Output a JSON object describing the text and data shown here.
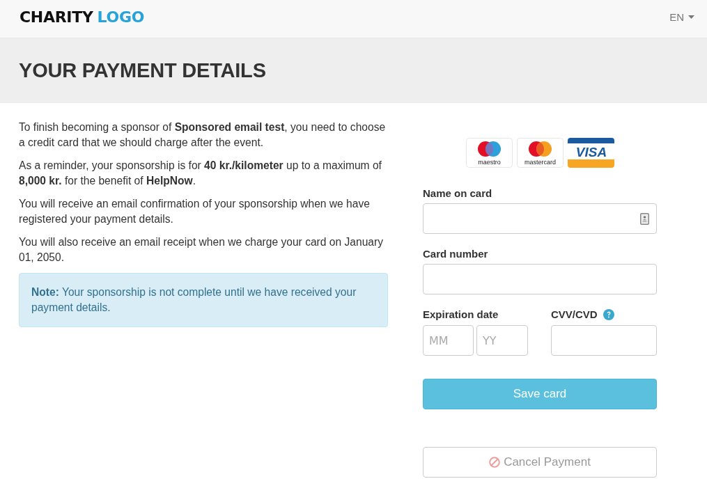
{
  "header": {
    "logo": {
      "primary": "CHARITY",
      "accent": "LOGO"
    },
    "language": "EN"
  },
  "page_title": "YOUR PAYMENT DETAILS",
  "intro_paragraphs": [
    "To finish becoming a sponsor of **Sponsored email test**, you need to choose a credit card that we should charge after the event.",
    "As a reminder, your sponsorship is for **40 kr./kilometer** up to a maximum of **8,000 kr.** for the benefit of **HelpNow**.",
    "You will receive an email confirmation of your sponsorship when we have registered your payment details.",
    "You will also receive an email receipt when we charge your card on January 01, 2050."
  ],
  "note": "**Note:** Your sponsorship is not complete until we have received your payment details.",
  "card_brands": [
    {
      "kind": "maestro",
      "label": "maestro"
    },
    {
      "kind": "mastercard",
      "label": "mastercard"
    },
    {
      "kind": "visa",
      "label": "VISA"
    }
  ],
  "form": {
    "name_on_card": {
      "label": "Name on card"
    },
    "card_number": {
      "label": "Card number"
    },
    "expiration": {
      "label": "Expiration date",
      "month": {
        "placeholder": "MM"
      },
      "year": {
        "placeholder": "YY"
      }
    },
    "cvv": {
      "label": "CVV/CVD"
    }
  },
  "buttons": [
    {
      "kind": "primary",
      "label": "Save card",
      "disabled": false
    },
    {
      "kind": "cancel",
      "label": "Cancel Payment",
      "disabled": true
    }
  ]
}
